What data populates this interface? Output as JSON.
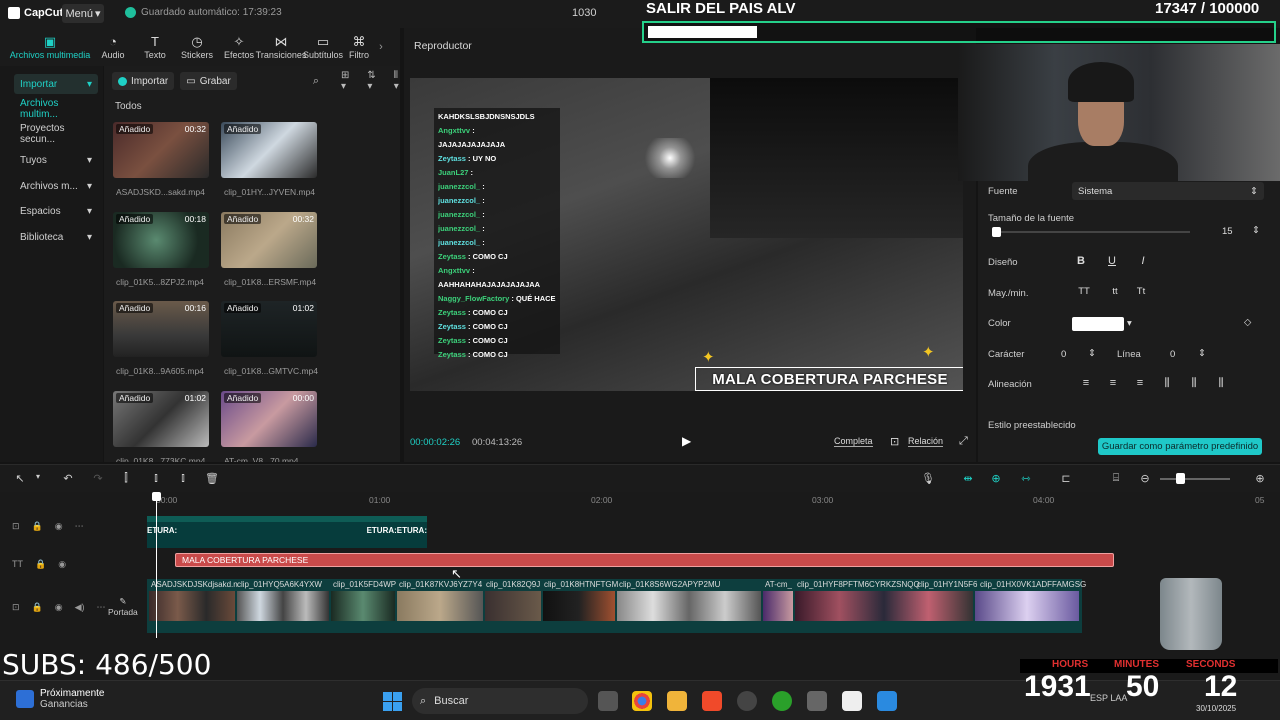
{
  "titlebar": {
    "app_name": "CapCut",
    "menu_label": "Menú",
    "autosave": "Guardado automático: 17:39:23",
    "project_id": "1030"
  },
  "tabs": [
    {
      "label": "Archivos multimedia",
      "icon": "media-icon"
    },
    {
      "label": "Audio",
      "icon": "audio-icon"
    },
    {
      "label": "Texto",
      "icon": "text-icon"
    },
    {
      "label": "Stickers",
      "icon": "sticker-icon"
    },
    {
      "label": "Efectos",
      "icon": "effects-icon"
    },
    {
      "label": "Transiciones",
      "icon": "transitions-icon"
    },
    {
      "label": "Subtítulos",
      "icon": "subtitles-icon"
    },
    {
      "label": "Filtro",
      "icon": "filter-icon"
    }
  ],
  "sidebar": {
    "items": [
      {
        "label": "Importar"
      },
      {
        "label": "Archivos multim..."
      },
      {
        "label": "Proyectos secun..."
      },
      {
        "label": "Tuyos"
      },
      {
        "label": "Archivos m..."
      },
      {
        "label": "Espacios"
      },
      {
        "label": "Biblioteca"
      }
    ]
  },
  "media": {
    "import_label": "Importar",
    "record_label": "Grabar",
    "filter_label": "Todos",
    "clips": [
      {
        "badge": "Añadido",
        "duration": "00:32",
        "name": "ASADJSKD...sakd.mp4"
      },
      {
        "badge": "Añadido",
        "duration": "",
        "name": "clip_01HY...JYVEN.mp4"
      },
      {
        "badge": "Añadido",
        "duration": "00:18",
        "name": "clip_01K5...8ZPJ2.mp4"
      },
      {
        "badge": "Añadido",
        "duration": "00:32",
        "name": "clip_01K8...ERSMF.mp4"
      },
      {
        "badge": "Añadido",
        "duration": "00:16",
        "name": "clip_01K8...9A605.mp4"
      },
      {
        "badge": "Añadido",
        "duration": "01:02",
        "name": "clip_01K8...GMTVC.mp4"
      },
      {
        "badge": "Añadido",
        "duration": "01:02",
        "name": "clip_01K8...773KC.mp4"
      },
      {
        "badge": "Añadido",
        "duration": "00:00",
        "name": "AT-cm_V8...70.mp4"
      }
    ]
  },
  "player": {
    "title": "Reproductor",
    "current_time": "00:00:02:26",
    "total_time": "00:04:13:26",
    "full_label": "Completa",
    "ratio_label": "Relación",
    "overlay_text": "MALA COBERTURA PARCHESE",
    "chat": [
      {
        "user": "",
        "msg": "KAHDKSLSBJDNSNSJDLS"
      },
      {
        "user": "Angxttvv",
        "msg": ":"
      },
      {
        "user": "",
        "msg": "JAJAJAJAJAJAJA"
      },
      {
        "user": "Zeytass",
        "msg": ": UY NO"
      },
      {
        "user": "JuanL27",
        "msg": ":"
      },
      {
        "user": "juanezzcol_",
        "msg": ":"
      },
      {
        "user": "juanezzcol_",
        "msg": ":"
      },
      {
        "user": "juanezzcol_",
        "msg": ":"
      },
      {
        "user": "juanezzcol_",
        "msg": ":"
      },
      {
        "user": "juanezzcol_",
        "msg": ":"
      },
      {
        "user": "Zeytass",
        "msg": ": COMO CJ"
      },
      {
        "user": "Angxttvv",
        "msg": ":"
      },
      {
        "user": "",
        "msg": "AAHHAHAHAJAJAJAJAJAA"
      },
      {
        "user": "Naggy_FlowFactory",
        "msg": ": QUÉ HACE"
      },
      {
        "user": "Zeytass",
        "msg": ": COMO CJ"
      },
      {
        "user": "Zeytass",
        "msg": ": COMO CJ"
      },
      {
        "user": "Zeytass",
        "msg": ": COMO CJ"
      },
      {
        "user": "Zeytass",
        "msg": ": COMO CJ"
      }
    ]
  },
  "stream_goal": {
    "title": "SALIR DEL PAIS ALV",
    "count": "17347  / 100000",
    "progress_fraction": 0.17347
  },
  "properties": {
    "font_label": "Fuente",
    "font_value": "Sistema",
    "size_label": "Tamaño de la fuente",
    "size_value": "15",
    "design_label": "Diseño",
    "case_label": "May./min.",
    "case_options": [
      "TT",
      "tt",
      "Tt"
    ],
    "color_label": "Color",
    "char_label": "Carácter",
    "char_value": "0",
    "line_label": "Línea",
    "line_value": "0",
    "align_label": "Alineación",
    "preset_label": "Estilo preestablecido",
    "save_preset_label": "Guardar como parámetro predefinido"
  },
  "timeline": {
    "ruler": [
      "00:00",
      "01:00",
      "02:00",
      "03:00",
      "04:00",
      "05"
    ],
    "sticker_clip_left": "ETURA:",
    "sticker_clip_right": "ETURA:ETURA:",
    "text_clip": "MALA COBERTURA PARCHESE",
    "cover_label": "Portada",
    "video_clips": [
      "ASADJSKDJSKdjsakd.n",
      "clip_01HYQ5A6K4YXW",
      "clip_01K5FD4WP",
      "clip_01K87KVJ6YZ7Y4",
      "clip_01K82Q9J",
      "clip_01K8HTNFTGM",
      "clip_01K8S6WG2APYP2MU",
      "AT-cm_",
      "clip_01HYF8PFTM6CYRKZSNQQ",
      "clip_01HY1N5F6",
      "clip_01HX0VK1ADFFAMGSG"
    ]
  },
  "stream_overlay": {
    "subs": "SUBS: 486/500",
    "timer_labels": [
      "HOURS",
      "MINUTES",
      "SECONDS"
    ],
    "timer_values": [
      "1931",
      "50",
      "12"
    ]
  },
  "taskbar": {
    "weather_title": "Próximamente",
    "weather_sub": "Ganancias",
    "search_label": "Buscar",
    "tray_lang_1": "ESP",
    "tray_lang_2": "LAA",
    "date": "30/10/2025"
  }
}
